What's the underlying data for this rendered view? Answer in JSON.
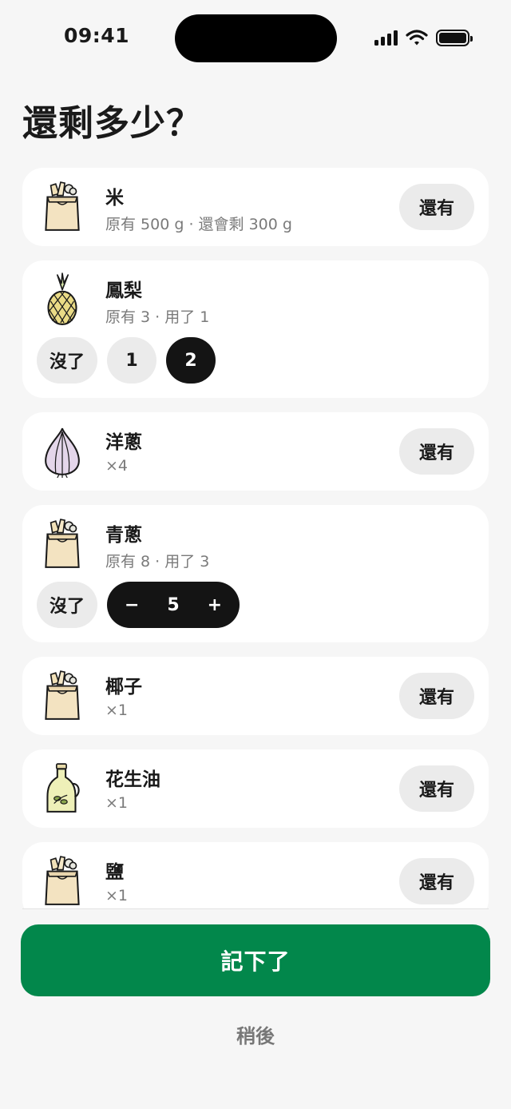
{
  "status_bar": {
    "time": "09:41"
  },
  "title": "還剩多少？",
  "items": [
    {
      "name": "米",
      "detail": "原有 500 g · 還會剩 300 g",
      "icon": "grocery-bag-icon",
      "action_label": "還有"
    },
    {
      "name": "鳳梨",
      "detail": "原有 3 · 用了 1",
      "icon": "pineapple-icon",
      "none_label": "沒了",
      "options": [
        "1",
        "2"
      ],
      "selected": "2"
    },
    {
      "name": "洋蔥",
      "detail": "×4",
      "icon": "onion-icon",
      "action_label": "還有"
    },
    {
      "name": "青蔥",
      "detail": "原有 8 · 用了 3",
      "icon": "grocery-bag-icon",
      "none_label": "沒了",
      "stepper": {
        "minus": "−",
        "value": "5",
        "plus": "+"
      }
    },
    {
      "name": "椰子",
      "detail": "×1",
      "icon": "grocery-bag-icon",
      "action_label": "還有"
    },
    {
      "name": "花生油",
      "detail": "×1",
      "icon": "oil-bottle-icon",
      "action_label": "還有"
    },
    {
      "name": "鹽",
      "detail": "×1",
      "icon": "grocery-bag-icon",
      "action_label": "還有"
    }
  ],
  "primary_button": "記下了",
  "secondary_button": "稍後",
  "colors": {
    "accent_green": "#02874b",
    "selected_chip": "#141414",
    "pill_bg": "#ebebeb"
  }
}
